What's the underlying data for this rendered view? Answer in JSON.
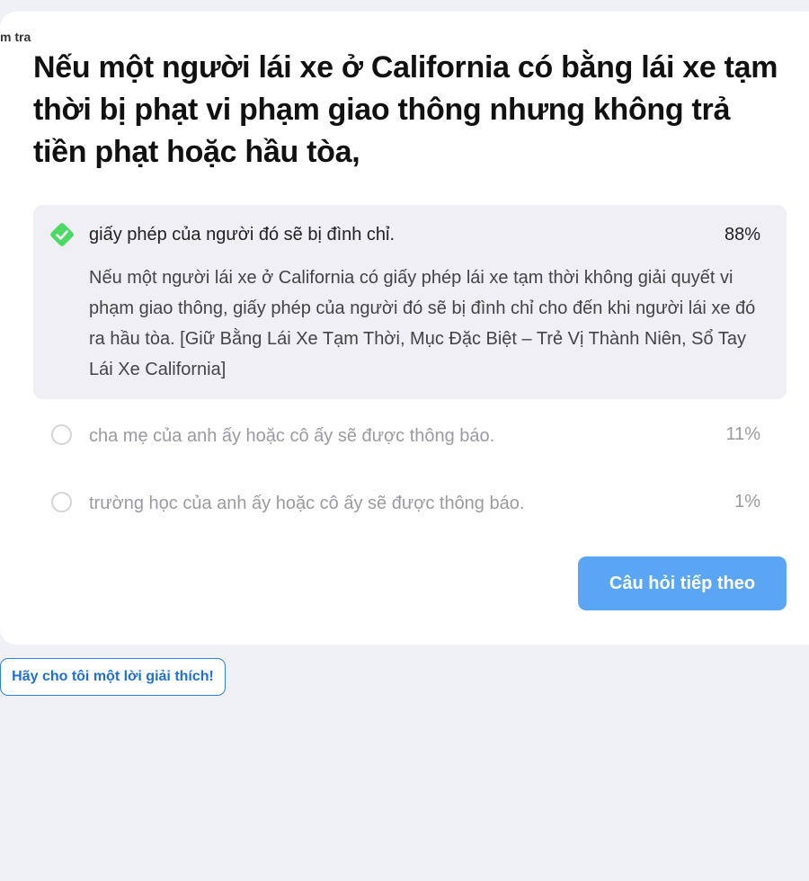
{
  "breadcrumb": "m tra",
  "question": "Nếu một người lái xe ở California có bằng lái xe tạm thời bị phạt vi phạm giao thông nhưng không trả tiền phạt hoặc hầu tòa,",
  "options": [
    {
      "label": "giấy phép của người đó sẽ bị đình chỉ.",
      "percent": "88%",
      "correct": true,
      "explanation": "Nếu một người lái xe ở California có giấy phép lái xe tạm thời không giải quyết vi phạm giao thông, giấy phép của người đó sẽ bị đình chỉ cho đến khi người lái xe đó ra hầu tòa. [Giữ Bằng Lái Xe Tạm Thời, Mục Đặc Biệt – Trẻ Vị Thành Niên, Sổ Tay Lái Xe California]"
    },
    {
      "label": "cha mẹ của anh ấy hoặc cô ấy sẽ được thông báo.",
      "percent": "11%",
      "correct": false
    },
    {
      "label": "trường học của anh ấy hoặc cô ấy sẽ được thông báo.",
      "percent": "1%",
      "correct": false
    }
  ],
  "next_button": "Câu hỏi tiếp theo",
  "explain_button": "Hãy cho tôi một lời giải thích!",
  "colors": {
    "background": "#f0f1f6",
    "card": "#ffffff",
    "correct_check": "#4cd964",
    "primary_button": "#5aa6f5",
    "link_blue": "#1f6fd6",
    "muted_text": "#9a9aa2"
  },
  "icons": {
    "correct": "check-diamond-icon",
    "unselected": "radio-circle-icon"
  }
}
